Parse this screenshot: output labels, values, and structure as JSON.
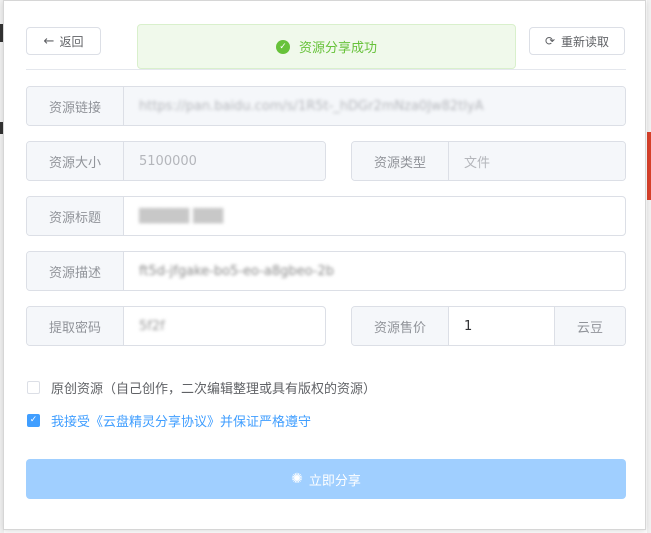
{
  "toolbar": {
    "back_label": "返回",
    "back_icon": "←",
    "reload_label": "重新读取",
    "reload_icon": "⟳"
  },
  "alert": {
    "message": "资源分享成功",
    "icon": "✓",
    "color": "#67c23a"
  },
  "form": {
    "link": {
      "label": "资源链接",
      "value": "https://pan.baidu.com/s/1R5t-_hDGr2mNza0Jw82tlyA"
    },
    "size": {
      "label": "资源大小",
      "value": "5100000"
    },
    "type": {
      "label": "资源类型",
      "value": "文件"
    },
    "title": {
      "label": "资源标题",
      "value": "█████ ███"
    },
    "desc": {
      "label": "资源描述",
      "value": "ft5d-jfgake-bo5-eo-a8gbeo-2b"
    },
    "code": {
      "label": "提取密码",
      "value": "5f2f"
    },
    "price": {
      "label": "资源售价",
      "value": "1",
      "unit": "云豆"
    }
  },
  "checkboxes": {
    "original": {
      "label": "原创资源（自己创作，二次编辑整理或具有版权的资源）",
      "checked": false
    },
    "agree": {
      "label": "我接受《云盘精灵分享协议》并保证严格遵守",
      "checked": true,
      "color": "#409eff"
    }
  },
  "submit": {
    "label": "立即分享",
    "icon": "✺",
    "color": "#a0cfff"
  }
}
